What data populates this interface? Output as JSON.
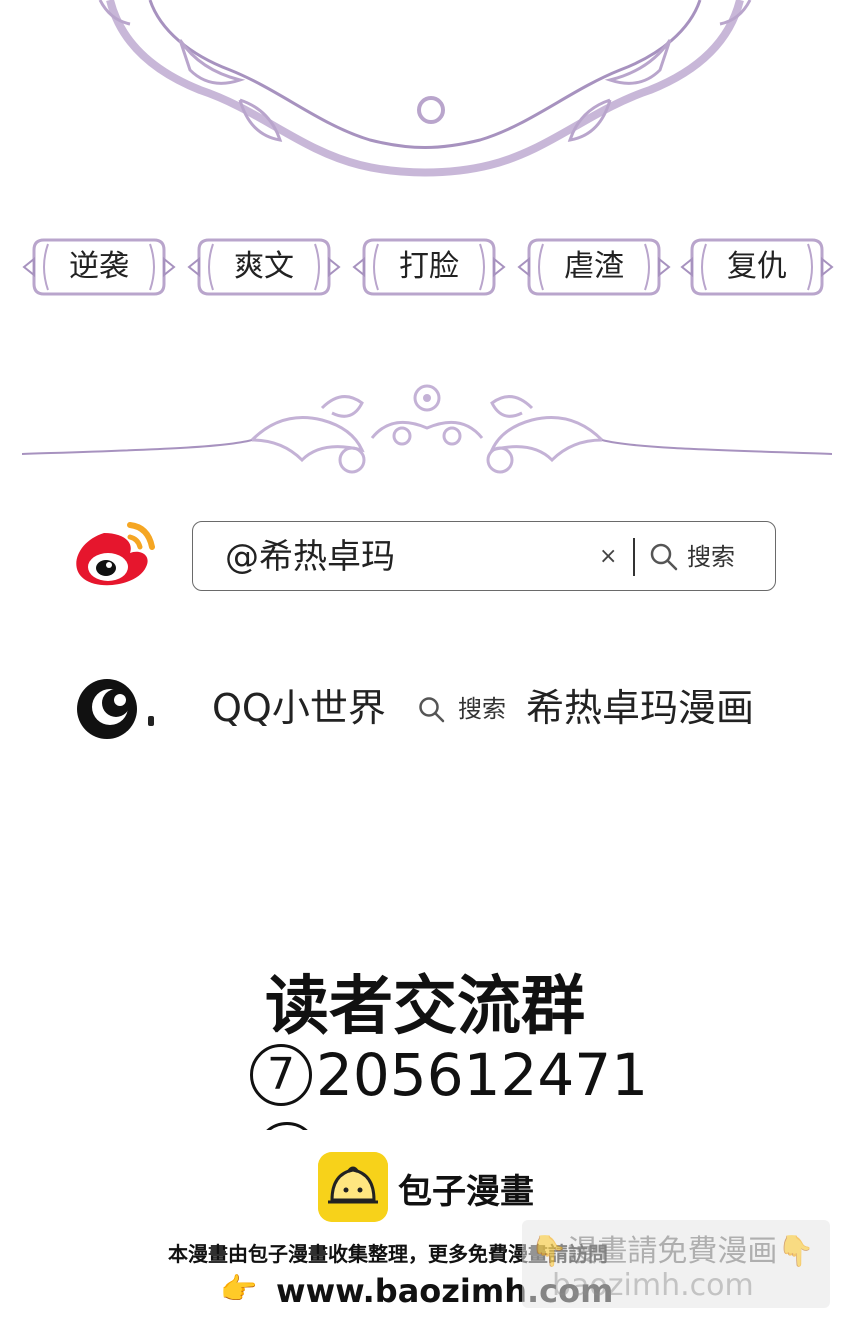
{
  "tags": [
    {
      "label": "逆袭"
    },
    {
      "label": "爽文"
    },
    {
      "label": "打脸"
    },
    {
      "label": "虐渣"
    },
    {
      "label": "复仇"
    }
  ],
  "weibo": {
    "search_value": "@希热卓玛",
    "clear_icon": "×",
    "search_label": "搜索"
  },
  "qq": {
    "platform": "QQ小世界",
    "search_label": "搜索",
    "account": "希热卓玛漫画"
  },
  "group": {
    "title": "读者交流群",
    "number_circle": "7",
    "number": "205612471"
  },
  "footer": {
    "brand": "包子漫畫",
    "notice": "本漫畫由包子漫畫收集整理，更多免費漫畫請訪問",
    "hand_icon": "👉",
    "url": "www.baozimh.com"
  },
  "watermark": {
    "line1": "👇漫畫請免費漫画👇",
    "line2": "baozimh.com"
  },
  "colors": {
    "ornament": "#b9a5cc",
    "ornament_dark": "#8f7aa8",
    "weibo_red": "#e6162d",
    "weibo_orange": "#f5a623",
    "brand_yellow": "#f7d21a"
  }
}
